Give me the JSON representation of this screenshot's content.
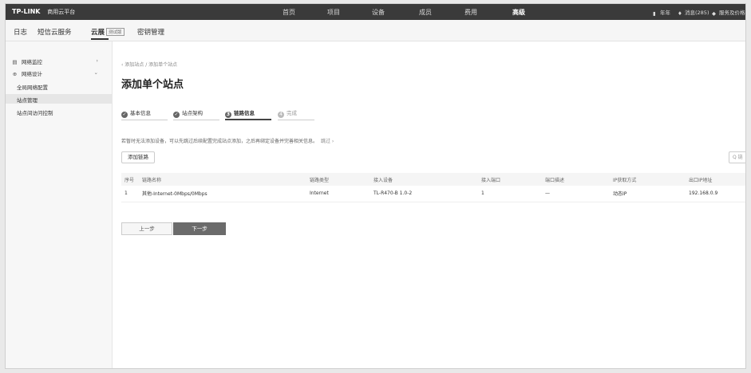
{
  "topbar": {
    "brand": "TP-LINK",
    "brand_sub": "商用云平台",
    "nav": [
      {
        "label": "首页",
        "active": false
      },
      {
        "label": "项目",
        "active": false
      },
      {
        "label": "设备",
        "active": false
      },
      {
        "label": "成员",
        "active": false
      },
      {
        "label": "费用",
        "active": false
      },
      {
        "label": "高级",
        "active": true
      }
    ],
    "right": {
      "year": "年年",
      "messages": "消息(285)",
      "service": "服务及价格"
    }
  },
  "subnav": {
    "items": [
      {
        "label": "日志",
        "active": false
      },
      {
        "label": "短信云服务",
        "active": false
      },
      {
        "label": "云展",
        "active": true,
        "badge": "测试版"
      },
      {
        "label": "密钥管理",
        "active": false
      }
    ]
  },
  "sidebar": {
    "items": [
      {
        "label": "网络监控",
        "icon": "monitor-icon",
        "chevron": "›"
      },
      {
        "label": "网络设计",
        "icon": "globe-icon",
        "chevron": "⌄"
      },
      {
        "label": "全局网络配置",
        "indent": true
      },
      {
        "label": "站点管理",
        "indent": true,
        "selected": true
      },
      {
        "label": "站点间访问控制",
        "indent": true
      }
    ]
  },
  "main": {
    "breadcrumb": "‹ 添加站点 / 添加单个站点",
    "title": "添加单个站点",
    "steps": [
      {
        "label": "基本信息",
        "state": "done",
        "marker": "✓"
      },
      {
        "label": "站点架构",
        "state": "done",
        "marker": "✓"
      },
      {
        "label": "链路信息",
        "state": "current",
        "marker": "3"
      },
      {
        "label": "完成",
        "state": "pending",
        "marker": "4"
      }
    ],
    "hint": "若暂时无法添加设备，可以先跳过后续配置完成站点添加，之后再绑定设备并完善相关信息。",
    "hint_skip": "跳过 ›",
    "add_button": "添加链路",
    "search_placeholder": "Q 链",
    "table": {
      "headers": [
        "序号",
        "链路名称",
        "链路类型",
        "接入设备",
        "接入端口",
        "端口描述",
        "IP获取方式",
        "出口IP地址"
      ],
      "rows": [
        [
          "1",
          "其他-Internet-0Mbps/0Mbps",
          "Internet",
          "TL-R470-B 1.0-2",
          "1",
          "—",
          "动态IP",
          "192.168.0.9"
        ]
      ]
    },
    "prev_button": "上一步",
    "next_button": "下一步"
  },
  "colors": {
    "topbar": "#3a3a3a",
    "primary_button": "#6b6b6b"
  }
}
